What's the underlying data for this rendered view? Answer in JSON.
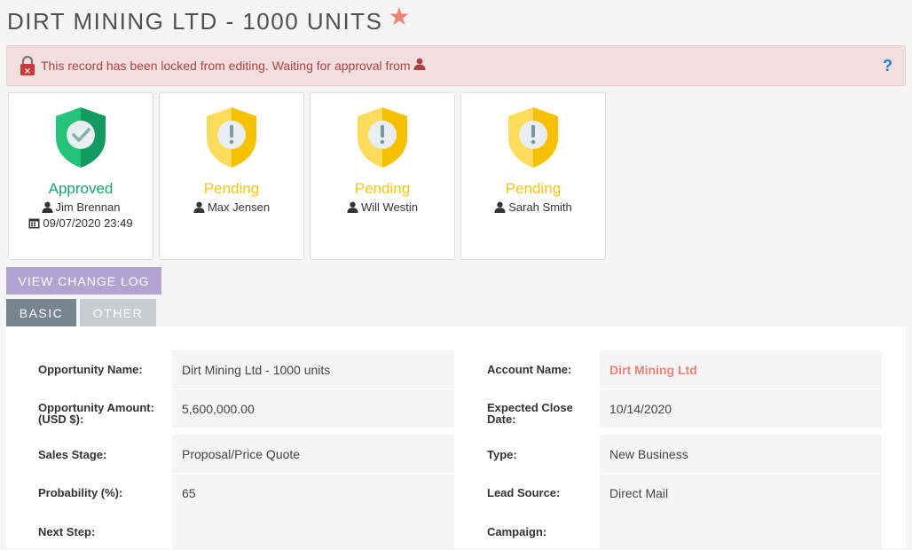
{
  "header": {
    "title": "DIRT MINING LTD - 1000 UNITS",
    "favorite_icon": "star-icon"
  },
  "alert": {
    "text": "This record has been locked from editing. Waiting for approval from",
    "lock_icon": "lock-icon",
    "help_label": "?"
  },
  "approvals": [
    {
      "status": "Approved",
      "user": "Jim Brennan",
      "date": "09/07/2020 23:49",
      "kind": "approved"
    },
    {
      "status": "Pending",
      "user": "Max Jensen",
      "kind": "pending"
    },
    {
      "status": "Pending",
      "user": "Will Westin",
      "kind": "pending"
    },
    {
      "status": "Pending",
      "user": "Sarah Smith",
      "kind": "pending"
    }
  ],
  "actions": {
    "view_change_log": "VIEW CHANGE LOG"
  },
  "tabs": [
    {
      "label": "BASIC",
      "active": true
    },
    {
      "label": "OTHER",
      "active": false
    }
  ],
  "fields": {
    "opportunity_name": {
      "label": "Opportunity Name:",
      "value": "Dirt Mining Ltd - 1000 units"
    },
    "account_name": {
      "label": "Account Name:",
      "value": "Dirt Mining Ltd"
    },
    "opportunity_amount": {
      "label": "Opportunity Amount:",
      "label2": "(USD $):",
      "value": "5,600,000.00"
    },
    "expected_close": {
      "label": "Expected Close",
      "label2": "Date:",
      "value": "10/14/2020"
    },
    "sales_stage": {
      "label": "Sales Stage:",
      "value": "Proposal/Price Quote"
    },
    "type": {
      "label": "Type:",
      "value": "New Business"
    },
    "probability": {
      "label": "Probability (%):",
      "value": "65"
    },
    "lead_source": {
      "label": "Lead Source:",
      "value": "Direct Mail"
    },
    "next_step": {
      "label": "Next Step:",
      "value": ""
    },
    "campaign": {
      "label": "Campaign:",
      "value": ""
    }
  },
  "colors": {
    "approved": "#1aa36b",
    "pending": "#f5c518",
    "accent": "#f08377",
    "alert_text": "#a94442"
  }
}
